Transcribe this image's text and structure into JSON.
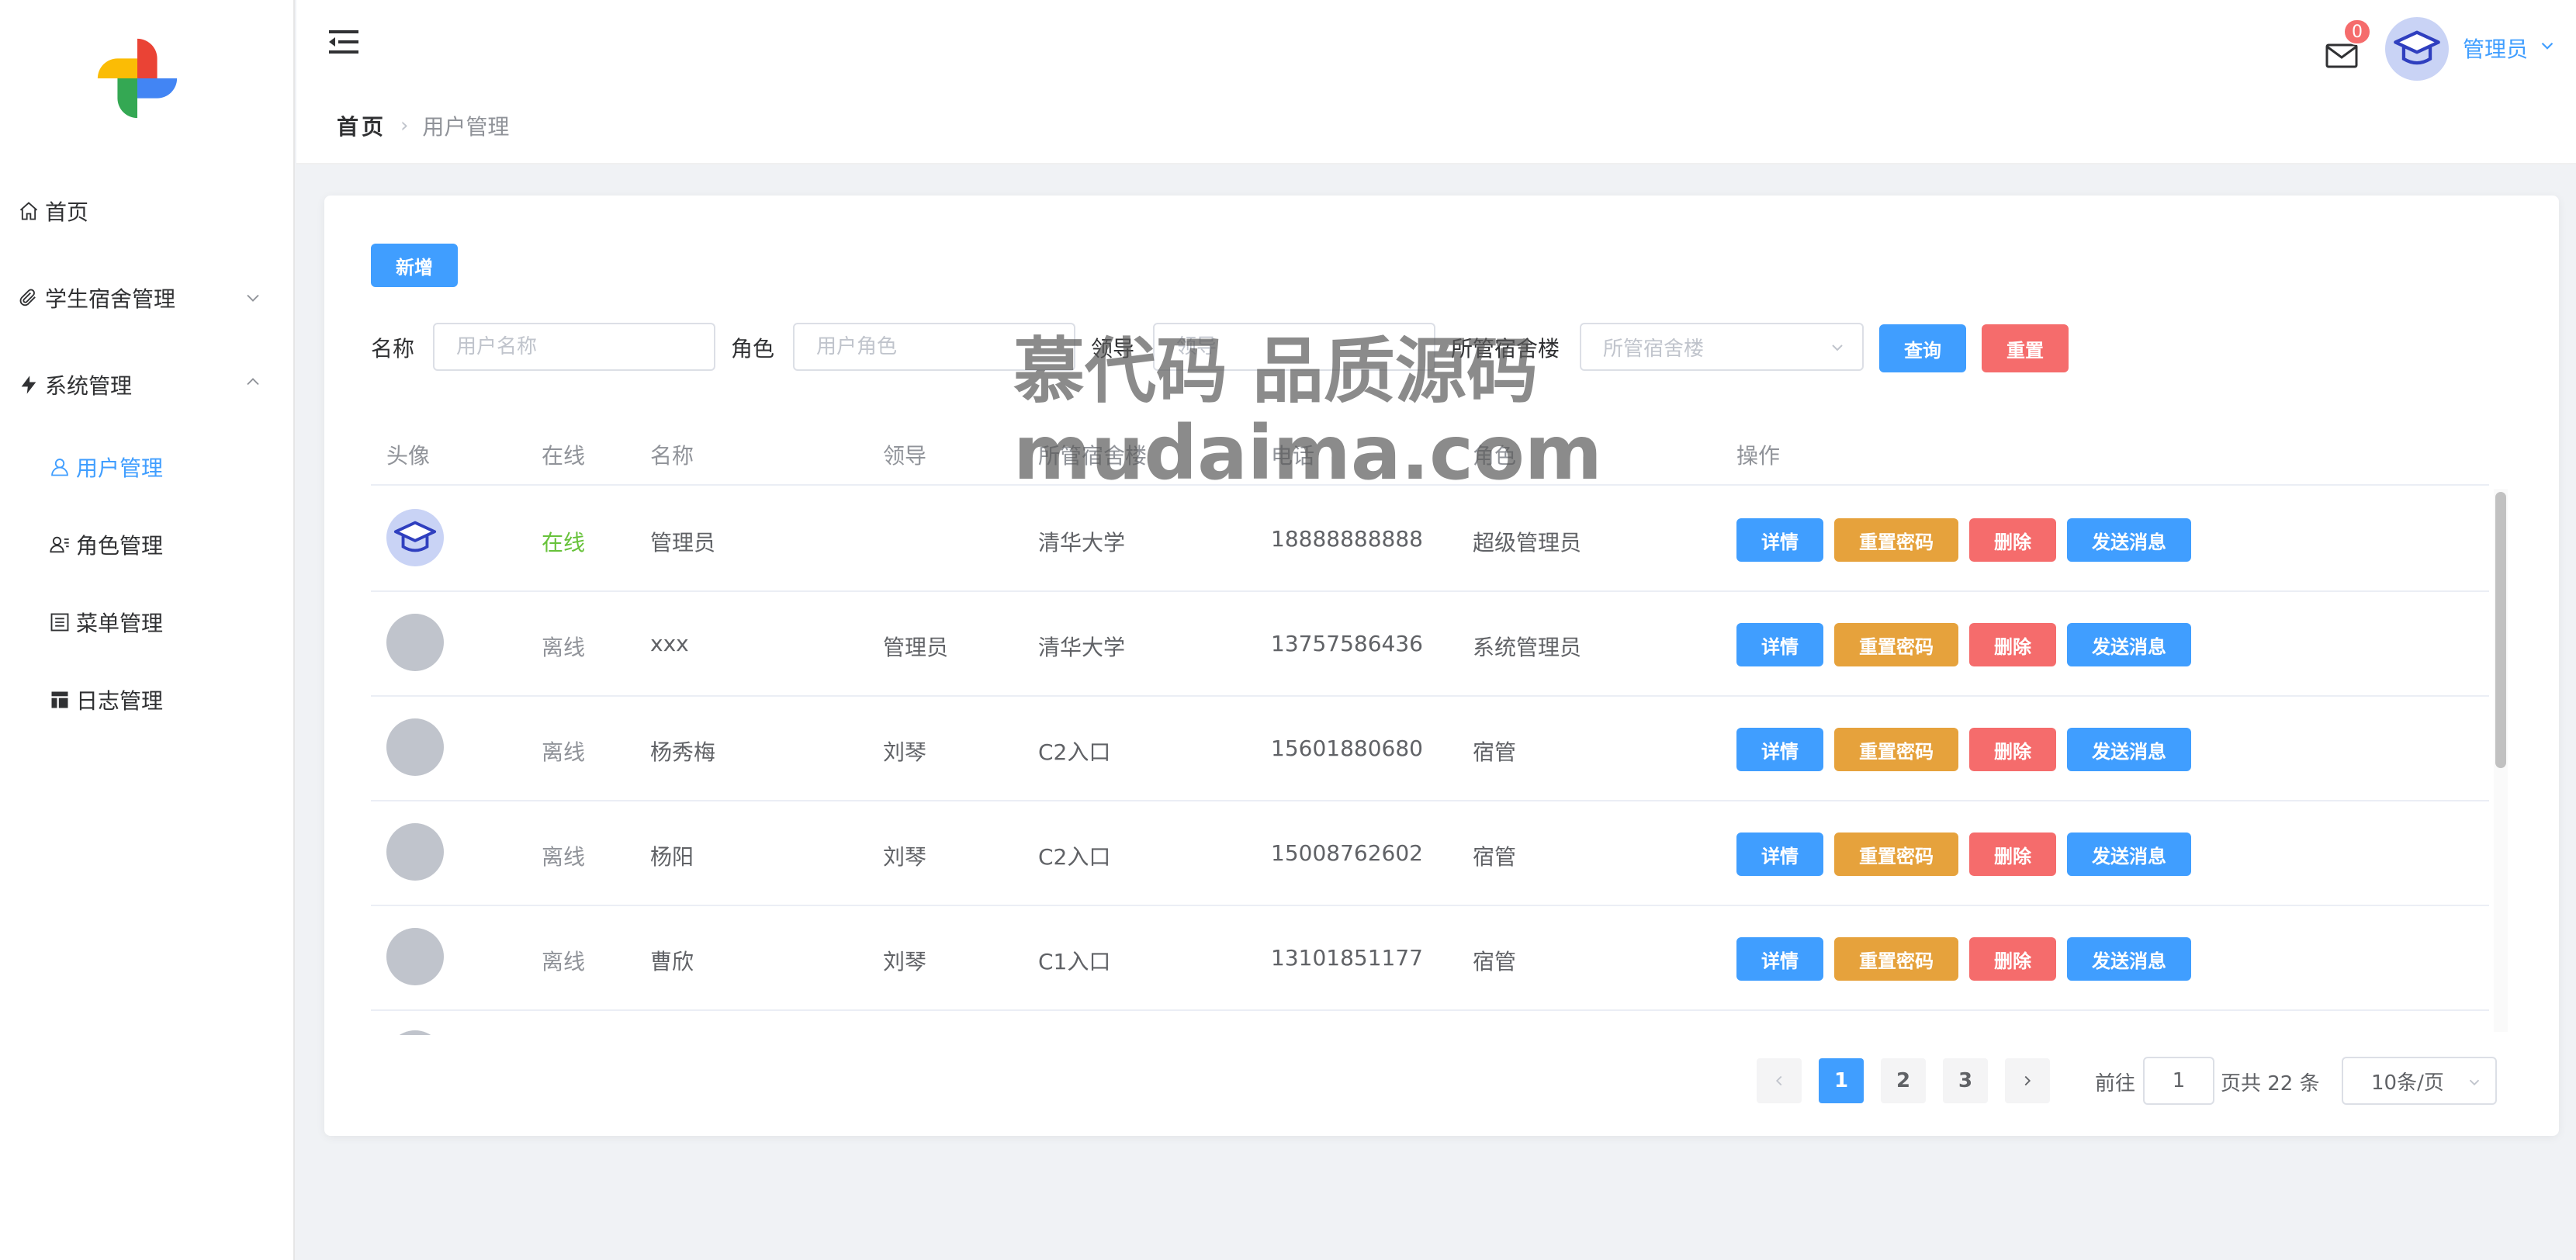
{
  "sidebar": {
    "items": [
      {
        "label": "首页",
        "icon": "home-icon"
      },
      {
        "label": "学生宿舍管理",
        "icon": "paperclip-icon"
      },
      {
        "label": "系统管理",
        "icon": "lightning-icon"
      },
      {
        "label": "用户管理",
        "icon": "user-icon"
      },
      {
        "label": "角色管理",
        "icon": "user-role-icon"
      },
      {
        "label": "菜单管理",
        "icon": "menu-list-icon"
      },
      {
        "label": "日志管理",
        "icon": "table-log-icon"
      }
    ]
  },
  "header": {
    "breadcrumb_home": "首页",
    "breadcrumb_current": "用户管理",
    "message_count": "0",
    "user_name": "管理员"
  },
  "toolbar": {
    "add_label": "新增"
  },
  "filters": {
    "name_label": "名称",
    "name_placeholder": "用户名称",
    "role_label": "角色",
    "role_placeholder": "用户角色",
    "leader_label": "领导",
    "leader_placeholder": "领导",
    "building_label": "所管宿舍楼",
    "building_placeholder": "所管宿舍楼",
    "search_label": "查询",
    "reset_label": "重置"
  },
  "table": {
    "headers": [
      "头像",
      "在线",
      "名称",
      "领导",
      "所管宿舍楼",
      "电话",
      "角色",
      "操作"
    ],
    "rows": [
      {
        "online": "在线",
        "name": "管理员",
        "leader": "",
        "building": "清华大学",
        "phone": "18888888888",
        "role": "超级管理员"
      },
      {
        "online": "离线",
        "name": "xxx",
        "leader": "管理员",
        "building": "清华大学",
        "phone": "13757586436",
        "role": "系统管理员"
      },
      {
        "online": "离线",
        "name": "杨秀梅",
        "leader": "刘琴",
        "building": "C2入口",
        "phone": "15601880680",
        "role": "宿管"
      },
      {
        "online": "离线",
        "name": "杨阳",
        "leader": "刘琴",
        "building": "C2入口",
        "phone": "15008762602",
        "role": "宿管"
      },
      {
        "online": "离线",
        "name": "曹欣",
        "leader": "刘琴",
        "building": "C1入口",
        "phone": "13101851177",
        "role": "宿管"
      }
    ],
    "actions": {
      "detail": "详情",
      "reset_password": "重置密码",
      "delete": "删除",
      "send_message": "发送消息"
    }
  },
  "pagination": {
    "pages": [
      "1",
      "2",
      "3"
    ],
    "current": "1",
    "goto_label": "前往",
    "goto_value": "1",
    "total_text": "页共 22 条",
    "page_size": "10条/页"
  },
  "watermark": {
    "line1": "慕代码 品质源码",
    "line2": "mudaima.com"
  },
  "colors": {
    "primary": "#409eff",
    "warning": "#e6a23c",
    "danger": "#f56c6c",
    "online": "#67c23a"
  }
}
